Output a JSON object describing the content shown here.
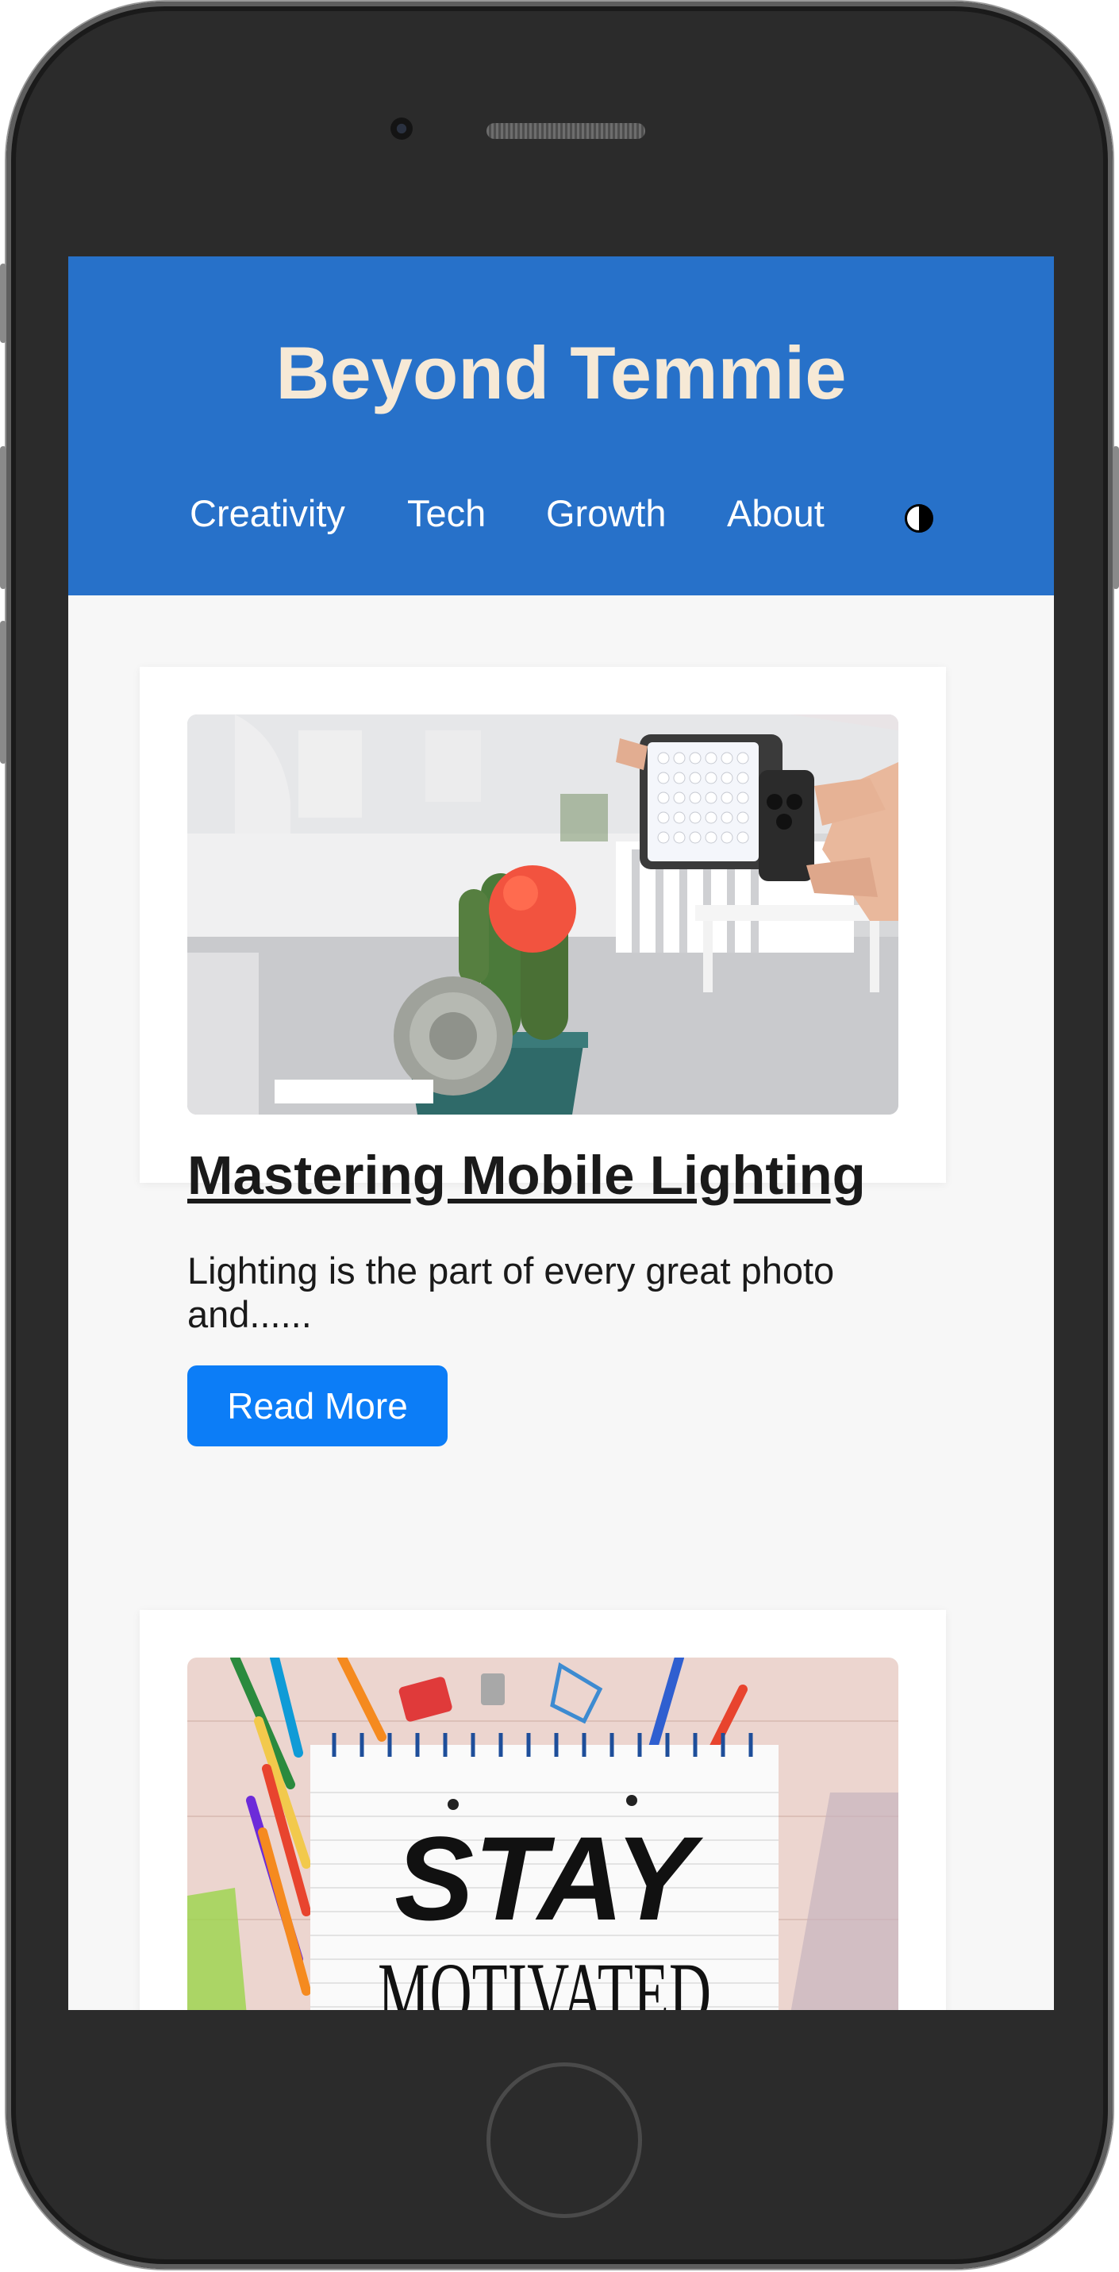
{
  "site": {
    "title": "Beyond Temmie"
  },
  "nav": {
    "items": [
      {
        "label": "Creativity"
      },
      {
        "label": "Tech"
      },
      {
        "label": "Growth"
      },
      {
        "label": "About"
      }
    ],
    "theme_toggle_icon": "half-moon-contrast-icon"
  },
  "posts": [
    {
      "title": "Mastering Mobile Lighting",
      "excerpt": "Lighting is the part of every great photo and......",
      "button_label": "Read More",
      "image": "photo of phone with LED light panel pointed at potted cacti"
    },
    {
      "image": "stay motivated notepad with colored pencils",
      "image_text_line1": "STAY",
      "image_text_line2": "MOTIVATED"
    }
  ],
  "colors": {
    "header_bg": "#2771c9",
    "title_color": "#f6e9d6",
    "button_bg": "#0c7df7",
    "page_bg": "#f7f7f7"
  }
}
